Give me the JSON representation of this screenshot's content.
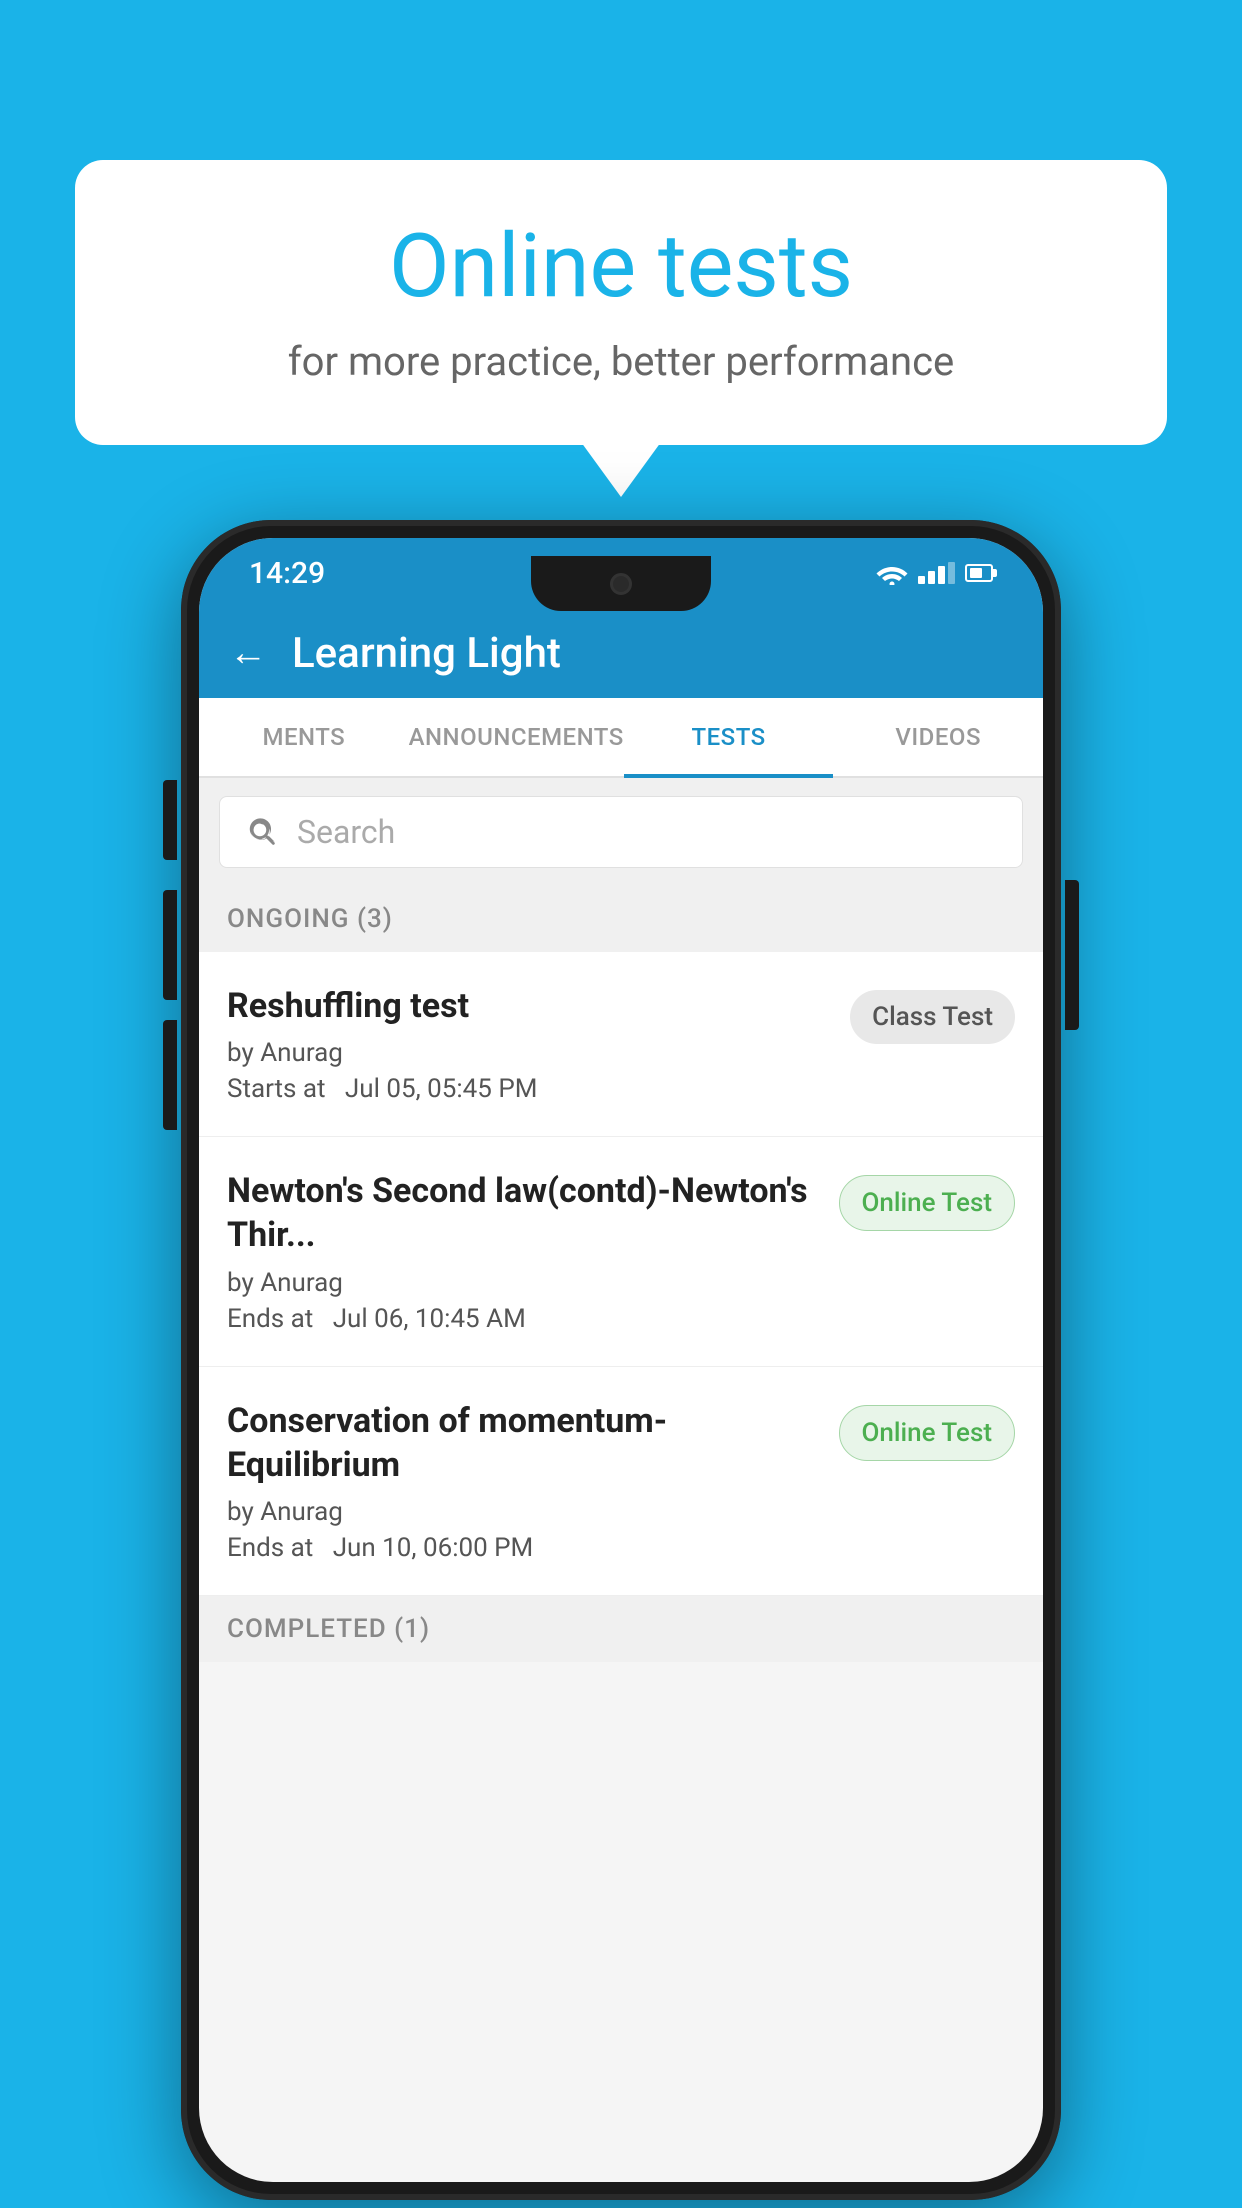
{
  "background": {
    "color": "#1ab3e8"
  },
  "bubble": {
    "title": "Online tests",
    "subtitle": "for more practice, better performance"
  },
  "phone": {
    "status_bar": {
      "time": "14:29",
      "icons": [
        "wifi",
        "signal",
        "battery"
      ]
    },
    "header": {
      "back_label": "←",
      "title": "Learning Light"
    },
    "tabs": [
      {
        "label": "MENTS",
        "active": false
      },
      {
        "label": "ANNOUNCEMENTS",
        "active": false
      },
      {
        "label": "TESTS",
        "active": true
      },
      {
        "label": "VIDEOS",
        "active": false
      }
    ],
    "search": {
      "placeholder": "Search"
    },
    "ongoing_section": {
      "label": "ONGOING (3)"
    },
    "tests": [
      {
        "name": "Reshuffling test",
        "by": "by Anurag",
        "time_label": "Starts at",
        "time": "Jul 05, 05:45 PM",
        "badge": "Class Test",
        "badge_type": "class"
      },
      {
        "name": "Newton's Second law(contd)-Newton's Thir...",
        "by": "by Anurag",
        "time_label": "Ends at",
        "time": "Jul 06, 10:45 AM",
        "badge": "Online Test",
        "badge_type": "online"
      },
      {
        "name": "Conservation of momentum-Equilibrium",
        "by": "by Anurag",
        "time_label": "Ends at",
        "time": "Jun 10, 06:00 PM",
        "badge": "Online Test",
        "badge_type": "online"
      }
    ],
    "completed_section": {
      "label": "COMPLETED (1)"
    }
  }
}
